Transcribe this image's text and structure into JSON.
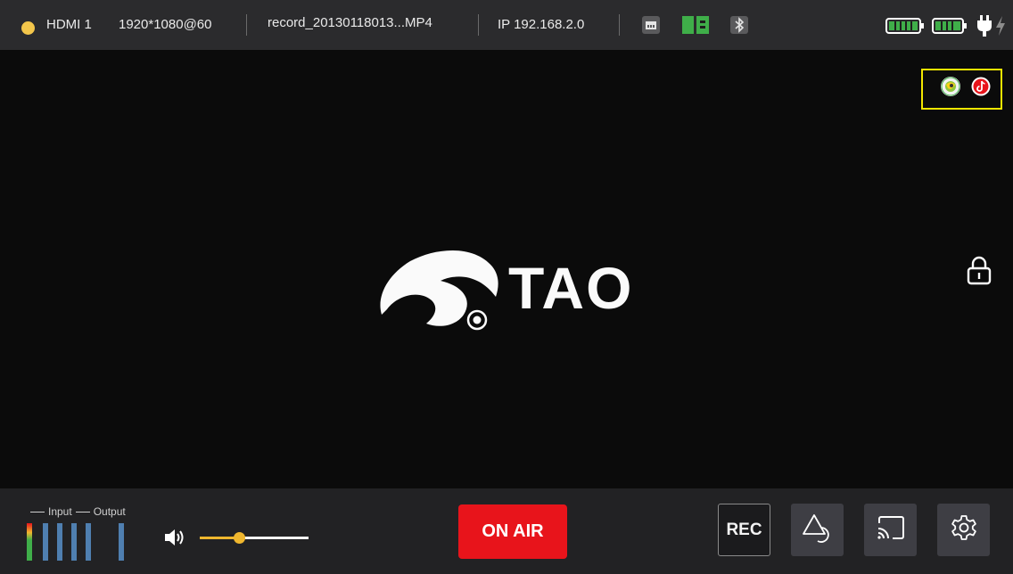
{
  "status_bar": {
    "source_label": "HDMI 1",
    "resolution": "1920*1080@60",
    "record_file": "record_20130118013...MP4",
    "ip_address": "IP 192.168.2.0",
    "source_dot_color": "#f3c64b",
    "icons": [
      "ethernet-icon",
      "sd-card-icon",
      "bluetooth-icon",
      "battery-1-icon",
      "battery-2-icon",
      "power-plug-icon",
      "charging-bolt-icon"
    ],
    "accent_green": "#3fae49"
  },
  "preview": {
    "logo_text": "TAO",
    "platform_icons": [
      "streaming-platform-icon",
      "tiktok-icon"
    ],
    "highlight_color": "#f3e600"
  },
  "bottom_bar": {
    "meter_input_label": "Input",
    "meter_output_label": "Output",
    "volume_level": 0.36,
    "on_air_label": "ON AIR",
    "on_air_color": "#e8141b",
    "rec_label": "REC",
    "buttons": [
      "shapes-icon",
      "cast-icon",
      "gear-icon"
    ]
  }
}
